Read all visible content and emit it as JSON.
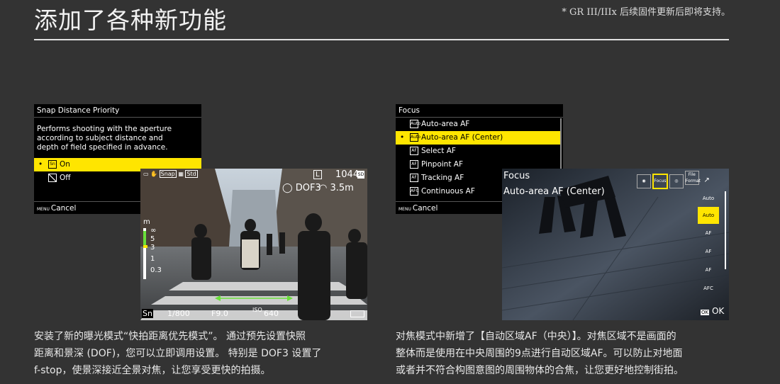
{
  "page": {
    "title": "添加了各种新功能",
    "note": "* GR III/IIIx 后续固件更新后即将支持。"
  },
  "left": {
    "menu_title": "Snap Distance Priority",
    "menu_desc": [
      "Performs shooting with the aperture",
      "according to subject distance and",
      "depth of field specified in advance."
    ],
    "options": [
      {
        "icon": "Sn",
        "label": "On",
        "selected": true
      },
      {
        "icon": "off",
        "label": "Off",
        "selected": false
      }
    ],
    "footer_key": "MENU",
    "footer_label": "Cancel",
    "hud": {
      "top_icons": "Snap",
      "std": "Std",
      "size": "L",
      "shots": "1044",
      "dof": "DOF3",
      "distance": "3.5m",
      "scale_unit": "m",
      "scale_marks": [
        "∞",
        "5",
        "3",
        "1",
        "0.3"
      ],
      "mode": "Sn",
      "shutter": "1/800",
      "aperture": "F9.0",
      "iso_label": "ISO",
      "iso": "640"
    },
    "caption": [
      "安装了新的曝光模式“快拍距离优先模式”。 通过预先设置快照",
      "距离和景深 (DOF)，您可以立即调用设置。 特别是 DOF3 设置了",
      "f-stop，使景深接近全景对焦，让您享受更快的拍摄。"
    ]
  },
  "right": {
    "menu_title": "Focus",
    "options": [
      {
        "icon": "Auto",
        "label": "Auto-area AF",
        "selected": false
      },
      {
        "icon": "Auto",
        "label": "Auto-area AF (Center)",
        "selected": true
      },
      {
        "icon": "AF",
        "label": "Select AF",
        "selected": false
      },
      {
        "icon": "AF",
        "label": "Pinpoint AF",
        "selected": false
      },
      {
        "icon": "AF",
        "label": "Tracking AF",
        "selected": false
      },
      {
        "icon": "AFC",
        "label": "Continuous AF",
        "selected": false
      }
    ],
    "footer_key": "MENU",
    "footer_label": "Cancel",
    "hud": {
      "title": "Focus",
      "subtitle": "Auto-area AF (Center)",
      "tabs": [
        "Focus",
        "File Format"
      ],
      "side_icons": [
        "Auto",
        "Auto",
        "AF",
        "AF",
        "AF",
        "AFC"
      ],
      "ok_key": "OK",
      "ok_label": "OK"
    },
    "caption": [
      "对焦模式中新增了【自动区域AF（中央）】。对焦区域不是画面的",
      "整体而是使用在中央周围的9点进行自动区域AF。可以防止对地面",
      "或者并不符合构图意图的周围物体的合焦，让您更好地控制街拍。"
    ]
  },
  "colors": {
    "background": "#333333",
    "highlight": "#ffe500",
    "dof_green": "#6adf3a"
  }
}
